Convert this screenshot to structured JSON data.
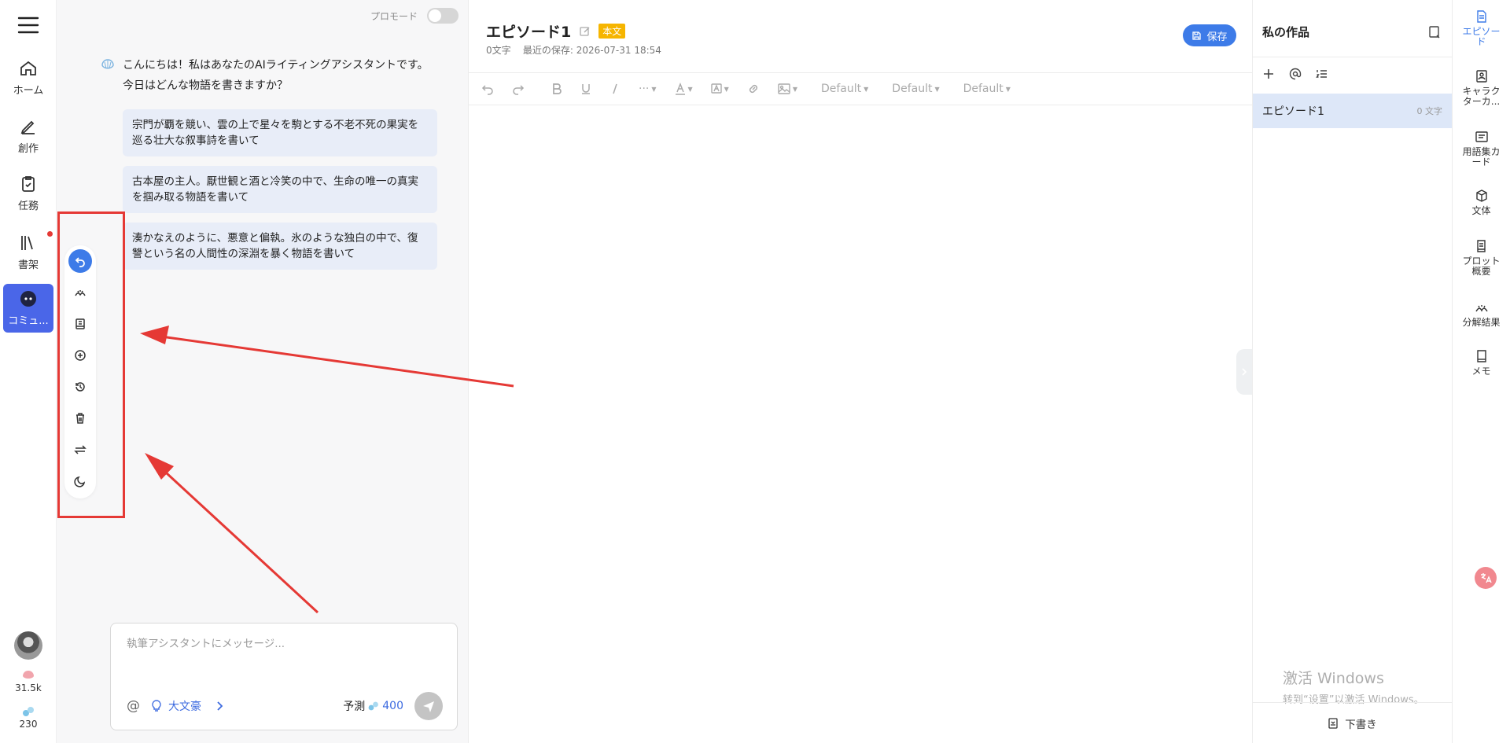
{
  "nav": {
    "items": [
      {
        "label": "ホーム",
        "icon": "home-icon"
      },
      {
        "label": "創作",
        "icon": "pencil-icon"
      },
      {
        "label": "任務",
        "icon": "clipboard-icon"
      },
      {
        "label": "書架",
        "icon": "bookshelf-icon"
      },
      {
        "label": "コミュ...",
        "icon": "discord-icon"
      }
    ],
    "stats": {
      "credits": "31.5k",
      "tokens": "230"
    }
  },
  "chat": {
    "pro_mode_label": "プロモード",
    "greeting_line1": "こんにちは！私はあなたのAIライティングアシスタントです。",
    "greeting_line2": "今日はどんな物語を書きますか？",
    "suggestions": [
      "宗門が覇を競い、雲の上で星々を駒とする不老不死の果実を巡る壮大な叙事詩を書いて",
      "古本屋の主人。厭世観と酒と冷笑の中で、生命の唯一の真実を掴み取る物語を書いて",
      "湊かなえのように、悪意と偏執。氷のような独白の中で、復讐という名の人間性の深淵を暴く物語を書いて"
    ],
    "input_placeholder": "執筆アシスタントにメッセージ...",
    "at_symbol": "@",
    "idea_label": "大文豪",
    "predict_label": "予測",
    "predict_value": "400"
  },
  "editor": {
    "title": "エピソード1",
    "tag": "本文",
    "word_count": "0文字",
    "last_saved": "最近の保存: 2026-07-31 18:54",
    "save_label": "保存",
    "font_selects": [
      "Default",
      "Default",
      "Default"
    ]
  },
  "works": {
    "title": "私の作品",
    "episodes": [
      {
        "name": "エピソード1",
        "count": "0 文字"
      }
    ],
    "draft_label": "下書き",
    "watermark_line1": "激活 Windows",
    "watermark_line2": "转到“设置”以激活 Windows。"
  },
  "right_tabs": [
    {
      "label": "エピソード",
      "icon": "document-icon",
      "active": true
    },
    {
      "label": "キャラクターカ...",
      "icon": "character-card-icon",
      "active": false
    },
    {
      "label": "用語集カード",
      "icon": "glossary-icon",
      "active": false
    },
    {
      "label": "文体",
      "icon": "cube-icon",
      "active": false
    },
    {
      "label": "プロット概要",
      "icon": "plot-icon",
      "active": false
    },
    {
      "label": "分解結果",
      "icon": "breakdown-icon",
      "active": false
    },
    {
      "label": "メモ",
      "icon": "notebook-icon",
      "active": false
    }
  ],
  "colors": {
    "accent": "#3d7be8",
    "nav_active": "#4a66e8",
    "annotation": "#e53935",
    "tag": "#f6b500"
  }
}
